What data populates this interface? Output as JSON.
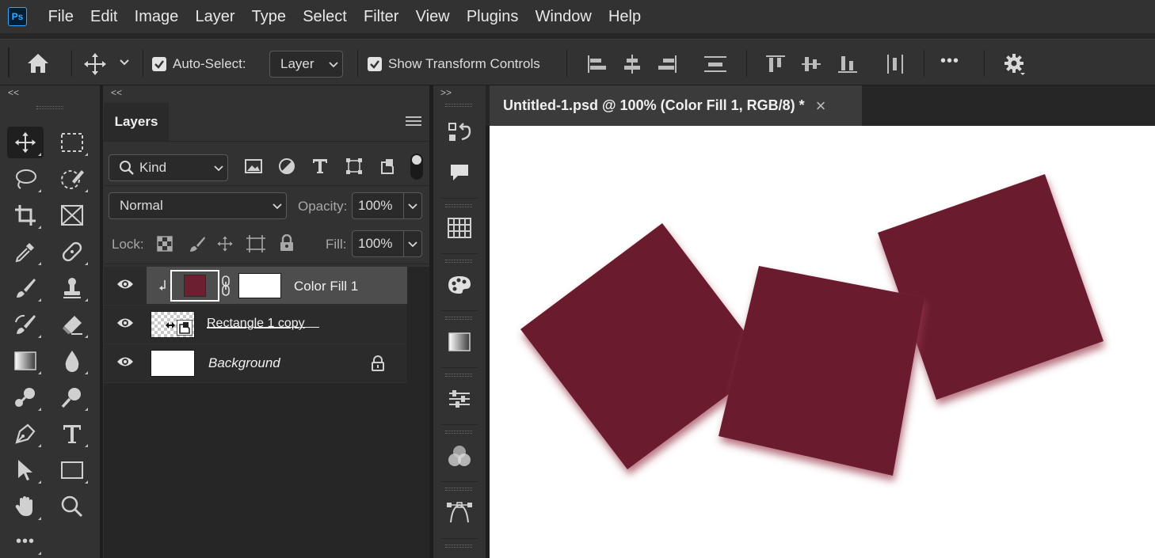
{
  "app": {
    "logo": "Ps"
  },
  "menu": [
    "File",
    "Edit",
    "Image",
    "Layer",
    "Type",
    "Select",
    "Filter",
    "View",
    "Plugins",
    "Window",
    "Help"
  ],
  "options": {
    "auto_select_label": "Auto-Select:",
    "auto_select_checked": true,
    "auto_select_target": "Layer",
    "show_transform_label": "Show Transform Controls",
    "show_transform_checked": true,
    "more_label": "•••"
  },
  "panels": {
    "collapse_left": "<<",
    "collapse_mid": "<<",
    "expand_right": ">>"
  },
  "layers_panel": {
    "tab_label": "Layers",
    "filter_kind": "Kind",
    "blend_mode": "Normal",
    "opacity_label": "Opacity:",
    "opacity_value": "100%",
    "lock_label": "Lock:",
    "fill_label": "Fill:",
    "fill_value": "100%",
    "layers": [
      {
        "name": "Color Fill 1",
        "selected": true,
        "visible": true,
        "clipped": true,
        "fill_color": "#6b1f2f"
      },
      {
        "name": "Rectangle 1 copy",
        "selected": false,
        "visible": true,
        "smart_object": true
      },
      {
        "name": "Background",
        "selected": false,
        "visible": true,
        "locked": true
      }
    ]
  },
  "document": {
    "tab_title": "Untitled-1.psd @ 100% (Color Fill 1, RGB/8) *",
    "close_icon": "×",
    "shape_color": "#6b1f2f"
  },
  "tools_more": "•••"
}
